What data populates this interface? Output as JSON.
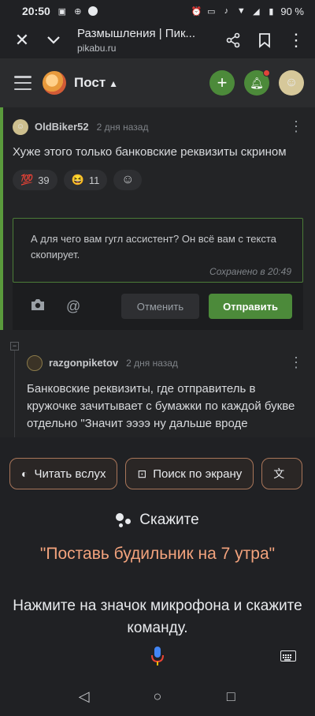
{
  "status_bar": {
    "time": "20:50",
    "battery": "90 %"
  },
  "browser": {
    "page_title": "Размышления | Пик...",
    "url": "pikabu.ru"
  },
  "site_header": {
    "section_title": "Пост"
  },
  "comment1": {
    "author": "OldBiker52",
    "date": "2 дня назад",
    "text": "Хуже этого только банковские реквизиты скрином",
    "reactions": [
      {
        "emoji": "💯",
        "count": "39"
      },
      {
        "emoji": "😆",
        "count": "11"
      }
    ]
  },
  "reply_form": {
    "text": "А для чего вам гугл ассистент? Он всё вам с текста скопирует.",
    "saved": "Сохранено в 20:49",
    "cancel_label": "Отменить",
    "send_label": "Отправить"
  },
  "comment2": {
    "author": "razgonpiketov",
    "date": "2 дня назад",
    "text": "Банковские реквизиты, где отправитель в кружочке зачитывает с бумажки по каждой букве отдельно \"Значит ээээ ну дальше вроде"
  },
  "assistant": {
    "chips": [
      {
        "icon": "read-aloud-icon",
        "label": "Читать вслух"
      },
      {
        "icon": "screen-search-icon",
        "label": "Поиск по экрану"
      },
      {
        "icon": "translate-icon",
        "label": ""
      }
    ],
    "prompt": "Скажите",
    "suggestion": "\"Поставь будильник на 7 утра\"",
    "hint": "Нажмите на значок микрофона и скажите команду."
  },
  "colors": {
    "accent_green": "#4c8a3a",
    "suggestion_orange": "#f3a37d"
  }
}
